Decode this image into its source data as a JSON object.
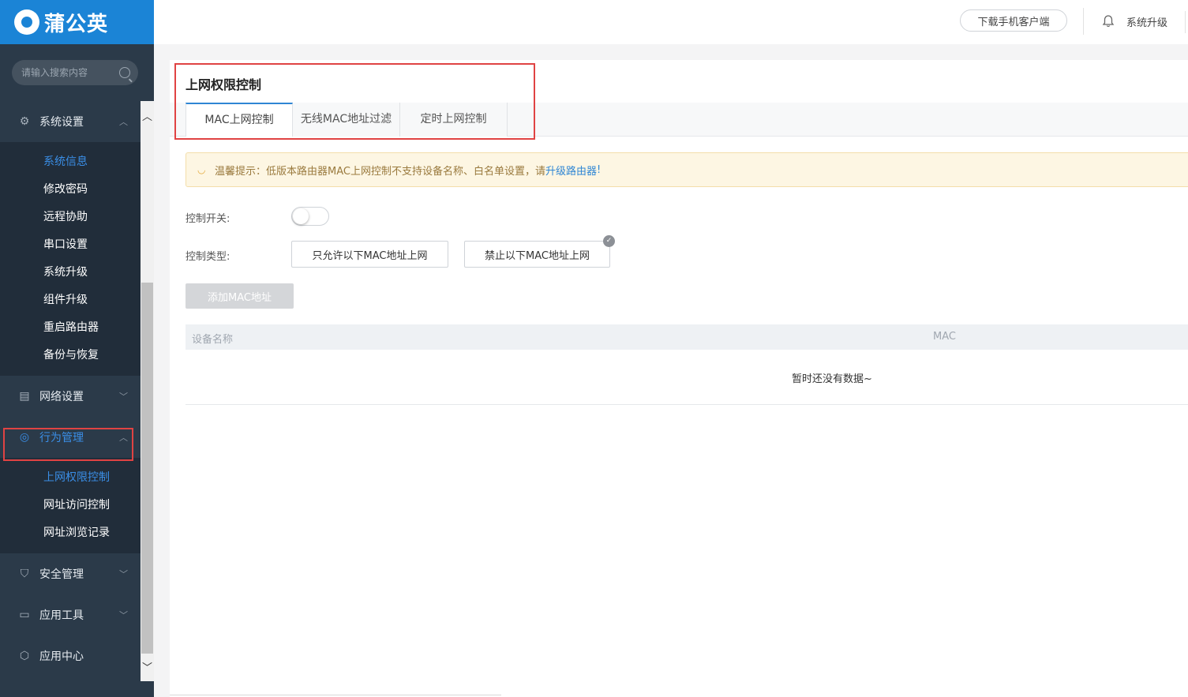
{
  "brand": {
    "name": "蒲公英"
  },
  "search": {
    "placeholder": "请输入搜索内容"
  },
  "sidebar": {
    "groups": [
      {
        "label": "系统设置",
        "icon": "gear-icon",
        "expanded": true,
        "items": [
          "系统信息",
          "修改密码",
          "远程协助",
          "串口设置",
          "系统升级",
          "组件升级",
          "重启路由器",
          "备份与恢复"
        ]
      },
      {
        "label": "网络设置",
        "icon": "document-icon",
        "expanded": false
      },
      {
        "label": "行为管理",
        "icon": "target-icon",
        "expanded": true,
        "active": true,
        "items": [
          "上网权限控制",
          "网址访问控制",
          "网址浏览记录"
        ]
      },
      {
        "label": "安全管理",
        "icon": "shield-icon",
        "expanded": false
      },
      {
        "label": "应用工具",
        "icon": "briefcase-icon",
        "expanded": false
      },
      {
        "label": "应用中心",
        "icon": "cube-icon",
        "expanded": false
      }
    ]
  },
  "header": {
    "download_label": "下载手机客户端",
    "upgrade_label": "系统升级"
  },
  "page": {
    "title": "上网权限控制",
    "tabs": [
      "MAC上网控制",
      "无线MAC地址过滤",
      "定时上网控制"
    ],
    "active_tab": 0,
    "notice": {
      "text": "温馨提示：低版本路由器MAC上网控制不支持设备名称、白名单设置，请",
      "link": "升级路由器",
      "suffix": "!"
    },
    "switch_label": "控制开关:",
    "switch_on": false,
    "type_label": "控制类型:",
    "type_options": [
      "只允许以下MAC地址上网",
      "禁止以下MAC地址上网"
    ],
    "selected_type": 1,
    "add_button": "添加MAC地址",
    "table": {
      "columns": [
        "设备名称",
        "MAC"
      ],
      "empty_text": "暂时还没有数据~"
    }
  },
  "colors": {
    "accent": "#2f86d4",
    "sidebar_bg": "#2b3a49",
    "highlight_frame": "#e04343"
  }
}
